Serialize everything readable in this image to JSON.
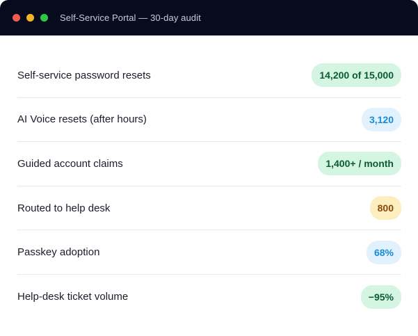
{
  "window": {
    "title": "Self-Service Portal — 30-day audit"
  },
  "colors": {
    "titlebar_bg": "#070b1e",
    "close": "#f25a4f",
    "minimize": "#f2b526",
    "maximize": "#2cc84a",
    "pill_green_bg": "#d3f5e1",
    "pill_green_fg": "#0c5a36",
    "pill_blue_bg": "#e2f2fd",
    "pill_blue_fg": "#1b8ad6",
    "pill_amber_bg": "#fdeec0",
    "pill_amber_fg": "#8a4a07"
  },
  "metrics": [
    {
      "label": "Self-service password resets",
      "value": "14,200 of 15,000",
      "tone": "green"
    },
    {
      "label": "AI Voice resets (after hours)",
      "value": "3,120",
      "tone": "blue"
    },
    {
      "label": "Guided account claims",
      "value": "1,400+ / month",
      "tone": "green"
    },
    {
      "label": "Routed to help desk",
      "value": "800",
      "tone": "amber"
    },
    {
      "label": "Passkey adoption",
      "value": "68%",
      "tone": "blue"
    },
    {
      "label": "Help-desk ticket volume",
      "value": "−95%",
      "tone": "green"
    }
  ]
}
